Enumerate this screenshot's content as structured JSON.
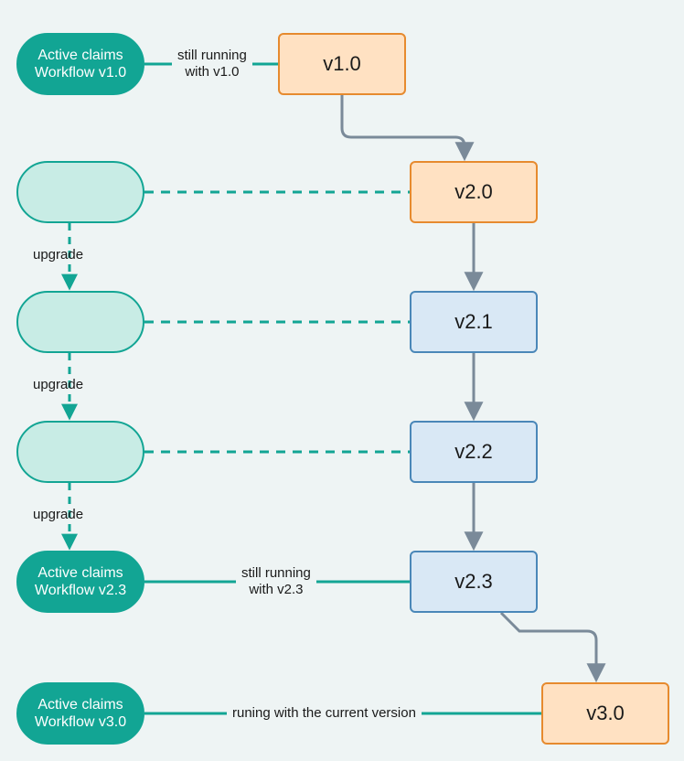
{
  "pills": {
    "p1": {
      "line1": "Active claims",
      "line2": "Workflow v1.0"
    },
    "p5": {
      "line1": "Active claims",
      "line2": "Workflow v2.3"
    },
    "p6": {
      "line1": "Active claims",
      "line2": "Workflow v3.0"
    }
  },
  "versions": {
    "v10": "v1.0",
    "v20": "v2.0",
    "v21": "v2.1",
    "v22": "v2.2",
    "v23": "v2.3",
    "v30": "v3.0"
  },
  "edges": {
    "e1_l1": "still running",
    "e1_l2": "with v1.0",
    "e5_l1": "still running",
    "e5_l2": "with v2.3",
    "e6": "runing with the current version",
    "upg": "upgrade"
  },
  "colors": {
    "teal": "#12a594",
    "gray": "#7a8a99"
  }
}
